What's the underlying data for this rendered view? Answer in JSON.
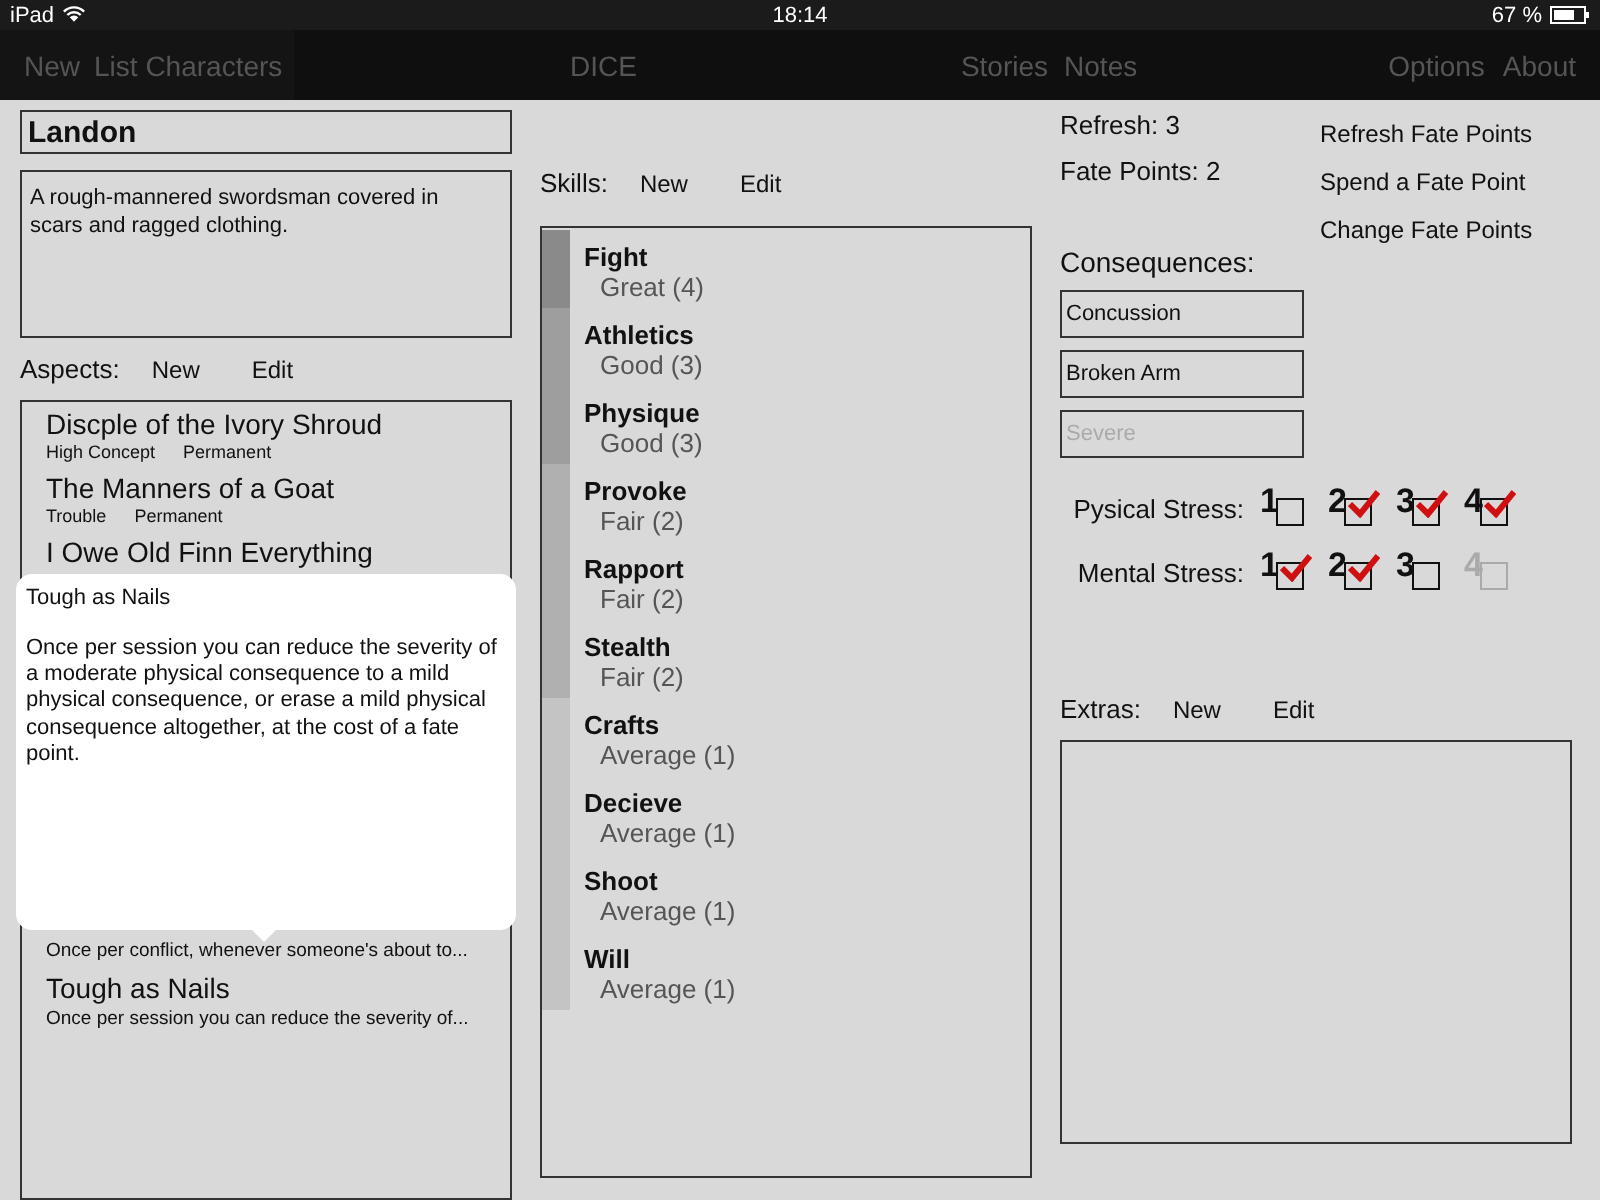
{
  "status_bar": {
    "device": "iPad",
    "time": "18:14",
    "battery": "67 %"
  },
  "nav": {
    "left": [
      "New",
      "List Characters"
    ],
    "center": "DICE",
    "middle": [
      "Stories",
      "Notes"
    ],
    "right": [
      "Options",
      "About"
    ]
  },
  "character": {
    "name": "Landon",
    "description": "A rough-mannered swordsman covered in scars and ragged clothing."
  },
  "aspects": {
    "label": "Aspects:",
    "actions": [
      "New",
      "Edit"
    ],
    "items": [
      {
        "name": "Discple of the Ivory Shroud",
        "tags": [
          "High Concept",
          "Permanent"
        ]
      },
      {
        "name": "The Manners of a Goat",
        "tags": [
          "Trouble",
          "Permanent"
        ]
      },
      {
        "name": "I Owe Old Finn Everything"
      },
      {
        "detail": "Once per conflict, whenever someone's about to..."
      },
      {
        "name": "Tough as Nails",
        "detail": "Once per session you can reduce the severity of..."
      }
    ]
  },
  "popover": {
    "title": "Tough as Nails",
    "text": "Once per session you can reduce the severity of a moderate physical consequence to a mild physical consequence, or erase a mild physical consequence altogether, at the cost of a fate point."
  },
  "skills": {
    "label": "Skills:",
    "actions": [
      "New",
      "Edit"
    ],
    "items": [
      {
        "name": "Fight",
        "rating": "Great (4)",
        "color": "#8a8a8a"
      },
      {
        "name": "Athletics",
        "rating": "Good (3)",
        "color": "#9e9e9e"
      },
      {
        "name": "Physique",
        "rating": "Good (3)",
        "color": "#9e9e9e"
      },
      {
        "name": "Provoke",
        "rating": "Fair (2)",
        "color": "#b0b0b0"
      },
      {
        "name": "Rapport",
        "rating": "Fair (2)",
        "color": "#b0b0b0"
      },
      {
        "name": "Stealth",
        "rating": "Fair (2)",
        "color": "#b0b0b0"
      },
      {
        "name": "Crafts",
        "rating": "Average (1)",
        "color": "#c4c4c4"
      },
      {
        "name": "Decieve",
        "rating": "Average (1)",
        "color": "#c4c4c4"
      },
      {
        "name": "Shoot",
        "rating": "Average (1)",
        "color": "#c4c4c4"
      },
      {
        "name": "Will",
        "rating": "Average (1)",
        "color": "#c4c4c4"
      }
    ]
  },
  "fate": {
    "refresh": "Refresh: 3",
    "fate_points": "Fate Points: 2",
    "actions": [
      "Refresh Fate Points",
      "Spend a Fate Point",
      "Change Fate Points"
    ]
  },
  "consequences": {
    "label": "Consequences:",
    "fields": [
      {
        "value": "Concussion"
      },
      {
        "value": "Broken Arm"
      },
      {
        "placeholder": "Severe"
      }
    ]
  },
  "stress": [
    {
      "label": "Pysical Stress:",
      "boxes": [
        {
          "number": "1",
          "checked": false,
          "disabled": false
        },
        {
          "number": "2",
          "checked": true,
          "disabled": false
        },
        {
          "number": "3",
          "checked": true,
          "disabled": false
        },
        {
          "number": "4",
          "checked": true,
          "disabled": false
        }
      ]
    },
    {
      "label": "Mental Stress:",
      "boxes": [
        {
          "number": "1",
          "checked": true,
          "disabled": false
        },
        {
          "number": "2",
          "checked": true,
          "disabled": false
        },
        {
          "number": "3",
          "checked": false,
          "disabled": false
        },
        {
          "number": "4",
          "checked": false,
          "disabled": true
        }
      ]
    }
  ],
  "extras": {
    "label": "Extras:",
    "actions": [
      "New",
      "Edit"
    ]
  }
}
